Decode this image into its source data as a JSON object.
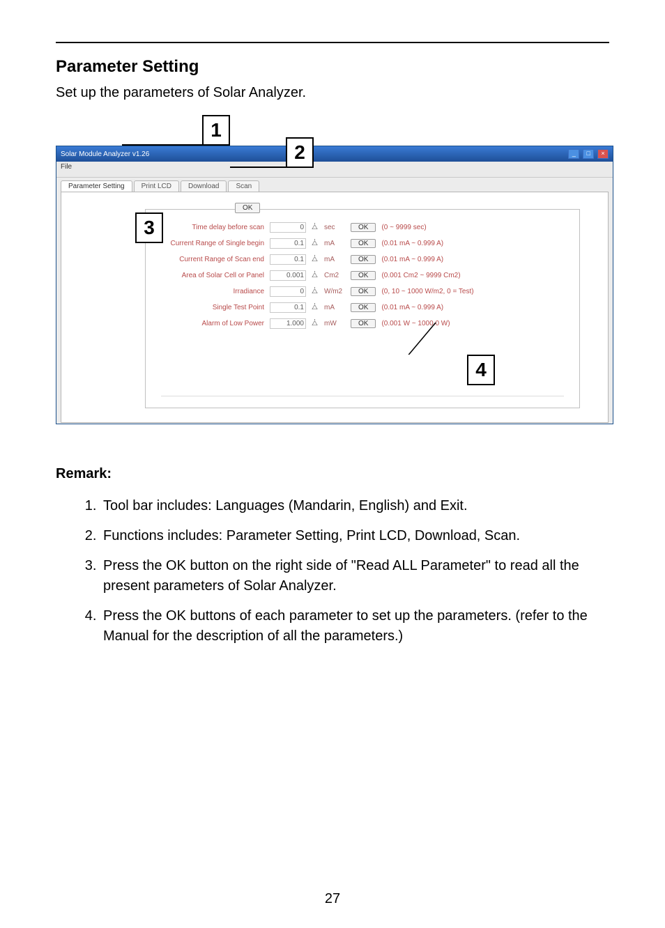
{
  "page": {
    "heading": "Parameter Setting",
    "intro": "Set up the parameters of Solar Analyzer.",
    "remark_heading": "Remark:",
    "page_number": "27"
  },
  "callouts": {
    "c1": "1",
    "c2": "2",
    "c3": "3",
    "c4": "4"
  },
  "appwin": {
    "title": "Solar Module Analyzer v1.26",
    "menubar": "File",
    "tabs": [
      "Parameter Setting",
      "Print LCD",
      "Download",
      "Scan"
    ],
    "read_all_button": "OK",
    "rows": [
      {
        "name": "Time delay before scan",
        "value": "0",
        "unit": "sec",
        "ok": "OK",
        "range": "(0 ~ 9999 sec)"
      },
      {
        "name": "Current Range of Single begin",
        "value": "0.1",
        "unit": "mA",
        "ok": "OK",
        "range": "(0.01 mA ~ 0.999 A)"
      },
      {
        "name": "Current Range of Scan end",
        "value": "0.1",
        "unit": "mA",
        "ok": "OK",
        "range": "(0.01 mA ~ 0.999 A)"
      },
      {
        "name": "Area of Solar Cell or Panel",
        "value": "0.001",
        "unit": "Cm2",
        "ok": "OK",
        "range": "(0.001 Cm2 ~ 9999 Cm2)"
      },
      {
        "name": "Irradiance",
        "value": "0",
        "unit": "W/m2",
        "ok": "OK",
        "range": "(0, 10 ~ 1000 W/m2, 0 = Test)"
      },
      {
        "name": "Single Test Point",
        "value": "0.1",
        "unit": "mA",
        "ok": "OK",
        "range": "(0.01 mA ~ 0.999 A)"
      },
      {
        "name": "Alarm of Low Power",
        "value": "1.000",
        "unit": "mW",
        "ok": "OK",
        "range": "(0.001 W ~ 1000.0 W)"
      }
    ]
  },
  "remarks": [
    "Tool bar includes: Languages (Mandarin, English) and Exit.",
    "Functions includes: Parameter Setting, Print LCD, Download, Scan.",
    "Press the OK button on the right side of \"Read ALL Parameter\" to read all the present parameters of Solar Analyzer.",
    "Press the OK buttons of each parameter to set up the parameters. (refer to the Manual for the description of all the parameters.)"
  ]
}
